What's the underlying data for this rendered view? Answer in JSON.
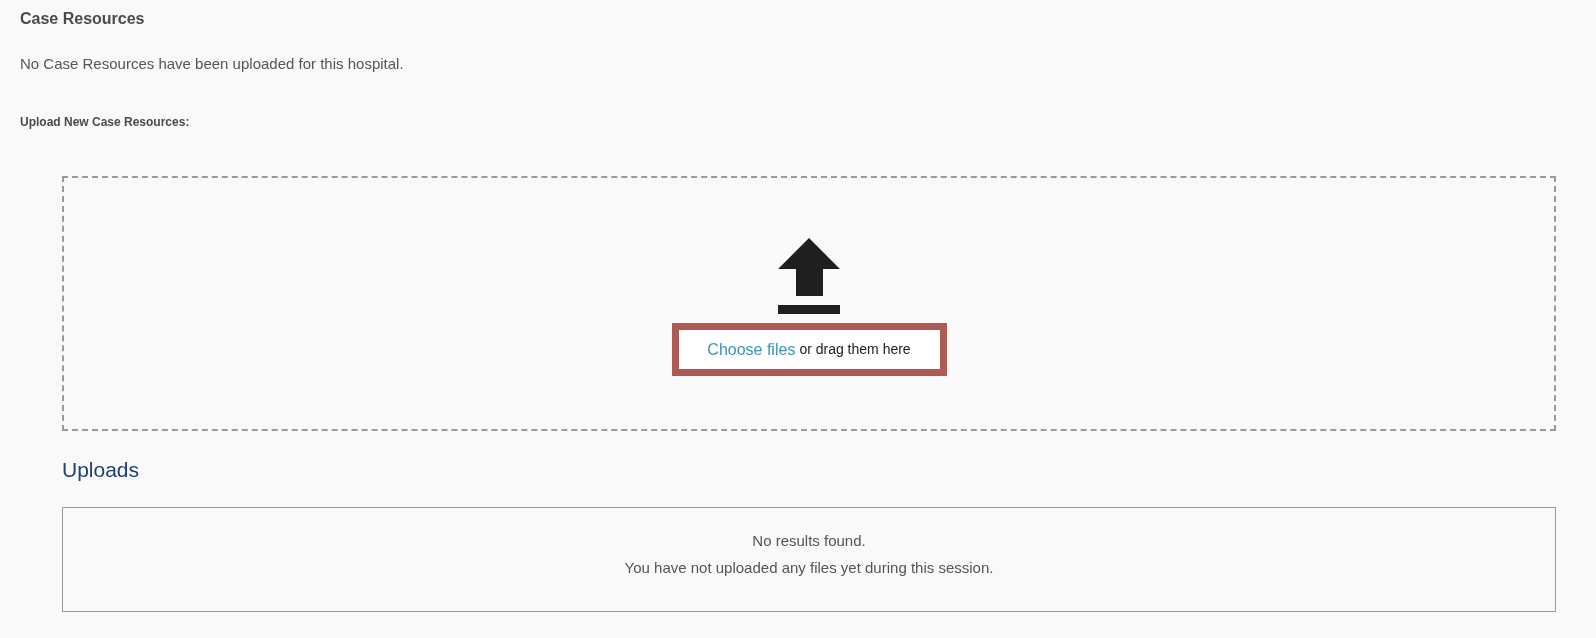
{
  "section": {
    "title": "Case Resources",
    "message": "No Case Resources have been uploaded for this hospital.",
    "upload_label": "Upload New Case Resources:"
  },
  "dropzone": {
    "highlighted": true,
    "link": "Choose files",
    "hint": "or drag them here"
  },
  "uploads": {
    "title": "Uploads",
    "messages": [
      "No results found.",
      "You have not uploaded any files yet during this session."
    ]
  }
}
